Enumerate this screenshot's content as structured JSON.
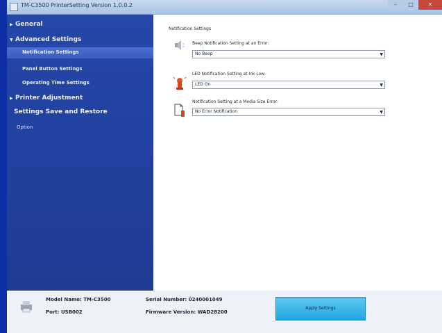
{
  "window": {
    "title": "TM-C3500 PrinterSetting Version 1.0.0.2"
  },
  "sidebar": {
    "items": [
      {
        "label": "General",
        "expanded": false
      },
      {
        "label": "Advanced Settings",
        "expanded": true
      },
      {
        "label": "Notification Settings",
        "selected": true
      },
      {
        "label": "Panel Button Settings"
      },
      {
        "label": "Operating Time Settings"
      },
      {
        "label": "Printer Adjustment",
        "expanded": false
      },
      {
        "label": "Settings Save and Restore"
      },
      {
        "label": "Option"
      }
    ]
  },
  "content": {
    "section_title": "Notification Settings",
    "settings": [
      {
        "label": "Beep Notification Setting at an Error:",
        "value": "No Beep",
        "icon": "speaker-icon"
      },
      {
        "label": "LED Notification Setting at Ink Low:",
        "value": "LED On",
        "icon": "led-lamp-icon"
      },
      {
        "label": "Notification Setting at a Media Size Error:",
        "value": "No Error Notification",
        "icon": "media-size-error-icon"
      }
    ]
  },
  "footer": {
    "model_name": "Model Name: TM-C3500",
    "port": "Port: USB002",
    "serial_number": "Serial Number: 0240001049",
    "firmware_version": "Firmware Version: WAD28200",
    "apply_label": "Apply Settings"
  },
  "colors": {
    "sidebar": "#2447a8",
    "selected_item": "#4a6fd0",
    "apply_button": "#21a6e2",
    "desktop": "#0c2fa8"
  }
}
